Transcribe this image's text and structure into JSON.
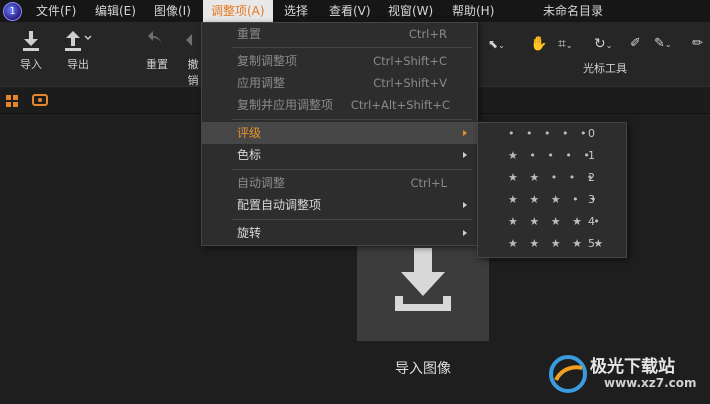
{
  "menubar": {
    "items": [
      "文件(F)",
      "编辑(E)",
      "图像(I)",
      "调整项(A)",
      "选择",
      "查看(V)",
      "视窗(W)",
      "帮助(H)"
    ],
    "document_title": "未命名目录"
  },
  "toolbar": {
    "import_label": "导入",
    "export_label": "导出",
    "reset_label": "重置",
    "undo_label": "撤销",
    "cursor_tools_label": "光标工具"
  },
  "adjust_menu": {
    "items": [
      {
        "label": "重置",
        "shortcut": "Ctrl+R",
        "state": "disabled"
      },
      {
        "label": "复制调整项",
        "shortcut": "Ctrl+Shift+C",
        "state": "disabled"
      },
      {
        "label": "应用调整",
        "shortcut": "Ctrl+Shift+V",
        "state": "disabled"
      },
      {
        "label": "复制并应用调整项",
        "shortcut": "Ctrl+Alt+Shift+C",
        "state": "disabled"
      },
      {
        "label": "评级",
        "shortcut": "",
        "state": "highlighted"
      },
      {
        "label": "色标",
        "shortcut": "",
        "state": "enabled"
      },
      {
        "label": "自动调整",
        "shortcut": "Ctrl+L",
        "state": "disabled"
      },
      {
        "label": "配置自动调整项",
        "shortcut": "",
        "state": "enabled"
      },
      {
        "label": "旋转",
        "shortcut": "",
        "state": "enabled"
      }
    ]
  },
  "rating_submenu": {
    "items": [
      {
        "stars": "• • • • •",
        "value": "0"
      },
      {
        "stars": "★ • • • •",
        "value": "1"
      },
      {
        "stars": "★ ★ • • •",
        "value": "2"
      },
      {
        "stars": "★ ★ ★ • •",
        "value": "3"
      },
      {
        "stars": "★ ★ ★ ★ •",
        "value": "4"
      },
      {
        "stars": "★ ★ ★ ★ ★",
        "value": "5"
      }
    ]
  },
  "main": {
    "import_image_label": "导入图像"
  },
  "watermark": {
    "name": "极光下载站",
    "url": "www.xz7.com"
  }
}
